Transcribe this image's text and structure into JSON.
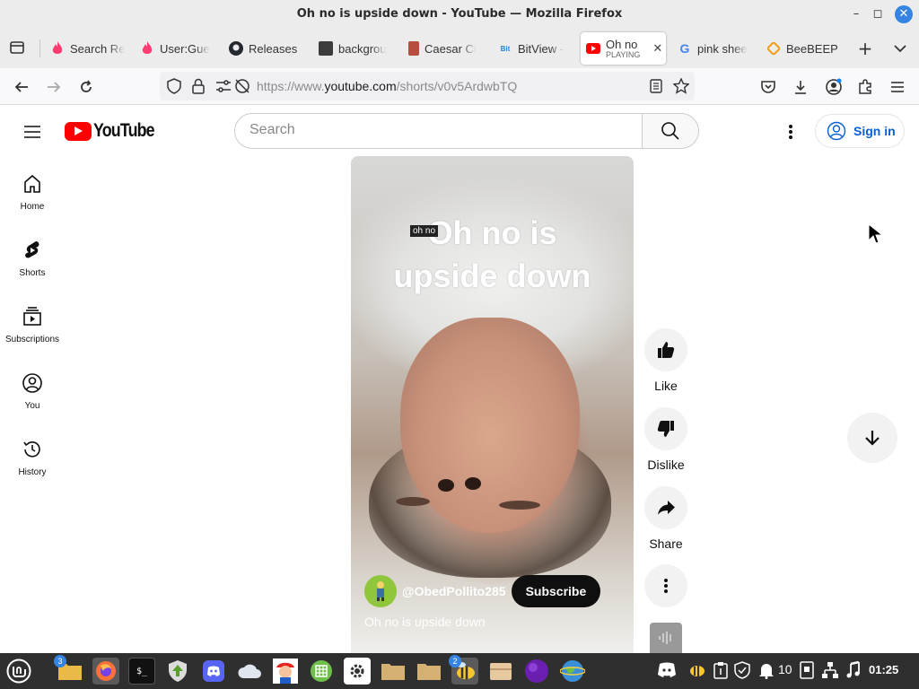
{
  "window": {
    "title": "Oh no is upside down - YouTube — Mozilla Firefox",
    "controls": {
      "minimize": "–",
      "maximize": "◻",
      "close": "✕"
    }
  },
  "tabs": [
    {
      "label": "Search Re",
      "icon": "tinder-flame-icon",
      "color": "#fe3c72"
    },
    {
      "label": "User:Gue",
      "icon": "tinder-flame-icon",
      "color": "#fe3c72"
    },
    {
      "label": "Releases",
      "icon": "github-icon",
      "color": "#24292f"
    },
    {
      "label": "backgrou",
      "icon": "terminal-page-icon",
      "color": "#3c3c3c"
    },
    {
      "label": "Caesar Ci",
      "icon": "cipher-page-icon",
      "color": "#b74d3e"
    },
    {
      "label": "BitView -",
      "icon": "bitview-icon",
      "color": "#2a7fd4"
    },
    {
      "label": "Oh no",
      "sublabel": "PLAYING",
      "icon": "youtube-icon",
      "color": "#ff0000",
      "active": true
    },
    {
      "label": "pink shee",
      "icon": "google-icon",
      "color": "#4285f4"
    },
    {
      "label": "BeeBEEP",
      "icon": "beebeep-icon",
      "color": "#f39c12"
    }
  ],
  "navbar": {
    "url_prefix": "https://www.",
    "url_domain": "youtube.com",
    "url_path": "/shorts/v0v5ArdwbTQ"
  },
  "youtube": {
    "logo_text": "YouTube",
    "search_placeholder": "Search",
    "sign_in_label": "Sign in",
    "sidebar": [
      {
        "label": "Home",
        "icon": "home-icon"
      },
      {
        "label": "Shorts",
        "icon": "shorts-icon"
      },
      {
        "label": "Subscriptions",
        "icon": "subscriptions-icon"
      },
      {
        "label": "You",
        "icon": "you-icon"
      },
      {
        "label": "History",
        "icon": "history-icon"
      }
    ],
    "video": {
      "overlay_title_line1": "Oh no is",
      "overlay_title_line2": "upside down",
      "tooltip": "oh no",
      "channel_handle": "@ObedPollito285",
      "subscribe_label": "Subscribe",
      "caption": "Oh no is upside down"
    },
    "actions": {
      "like": "Like",
      "dislike": "Dislike",
      "share": "Share"
    }
  },
  "taskbar": {
    "files_badge": "3",
    "bee_badge": "2",
    "tray_count": "10",
    "clock": "01:25"
  }
}
